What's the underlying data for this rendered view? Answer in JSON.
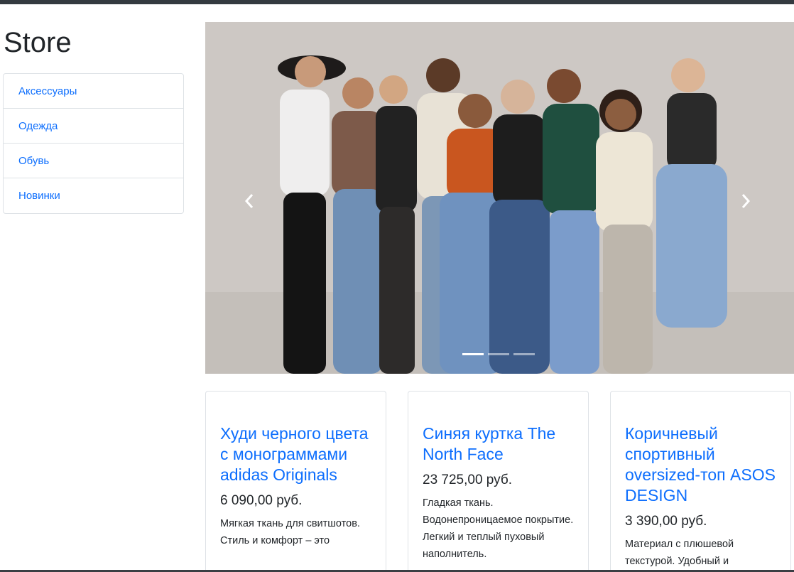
{
  "header": {
    "store_title": "Store"
  },
  "sidebar": {
    "items": [
      {
        "label": "Аксессуары"
      },
      {
        "label": "Одежда"
      },
      {
        "label": "Обувь"
      },
      {
        "label": "Новинки"
      }
    ]
  },
  "carousel": {
    "image_icon": "group-photo-people-in-denim",
    "prev_icon": "chevron-left-icon",
    "next_icon": "chevron-right-icon",
    "slide_count": 3,
    "active_slide": 1
  },
  "products": [
    {
      "title": "Худи черного цвета с монограммами adidas Originals",
      "price": "6 090,00 руб.",
      "description": "Мягкая ткань для свитшотов. Стиль и комфорт – это"
    },
    {
      "title": "Синяя куртка The North Face",
      "price": "23 725,00 руб.",
      "description": "Гладкая ткань. Водонепроницаемое покрытие. Легкий и теплый пуховый наполнитель."
    },
    {
      "title": "Коричневый спортивный oversized-топ ASOS DESIGN",
      "price": "3 390,00 руб.",
      "description": "Материал с плюшевой текстурой. Удобный и"
    }
  ],
  "colors": {
    "accent": "#0d6efd",
    "topbar": "#343a40",
    "border": "#dee2e6"
  }
}
